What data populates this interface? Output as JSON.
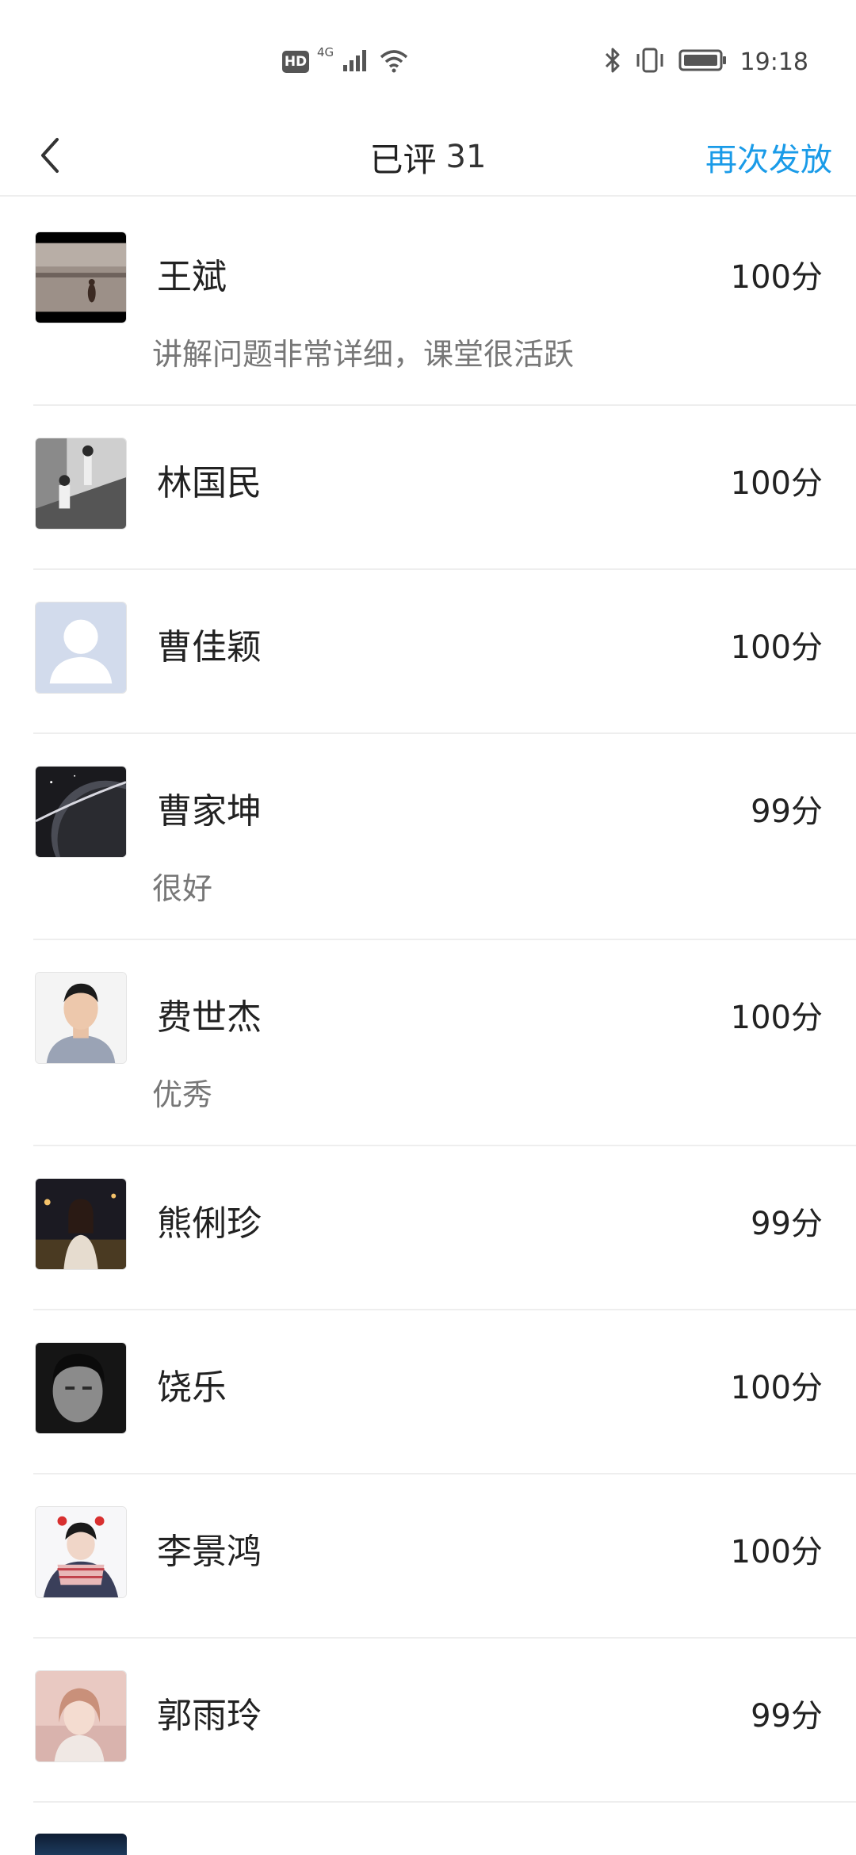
{
  "status_bar": {
    "hd_label": "HD",
    "network_label": "4G",
    "time": "19:18",
    "icons": [
      "hd-icon",
      "signal-icon",
      "wifi-icon",
      "bluetooth-icon",
      "vibrate-icon",
      "battery-icon"
    ]
  },
  "nav": {
    "title": "已评",
    "count": "31",
    "action_label": "再次发放",
    "accent_color": "#1a9be8"
  },
  "students": [
    {
      "name": "王斌",
      "score": "100分",
      "comment": "讲解问题非常详细，课堂很活跃",
      "avatar": "photo"
    },
    {
      "name": "林国民",
      "score": "100分",
      "comment": "",
      "avatar": "photo"
    },
    {
      "name": "曹佳颖",
      "score": "100分",
      "comment": "",
      "avatar": "default-user"
    },
    {
      "name": "曹家坤",
      "score": "99分",
      "comment": "很好",
      "avatar": "photo"
    },
    {
      "name": "费世杰",
      "score": "100分",
      "comment": "优秀",
      "avatar": "photo"
    },
    {
      "name": "熊俐珍",
      "score": "99分",
      "comment": "",
      "avatar": "photo"
    },
    {
      "name": "饶乐",
      "score": "100分",
      "comment": "",
      "avatar": "photo"
    },
    {
      "name": "李景鸿",
      "score": "100分",
      "comment": "",
      "avatar": "photo"
    },
    {
      "name": "郭雨玲",
      "score": "99分",
      "comment": "",
      "avatar": "photo"
    }
  ]
}
